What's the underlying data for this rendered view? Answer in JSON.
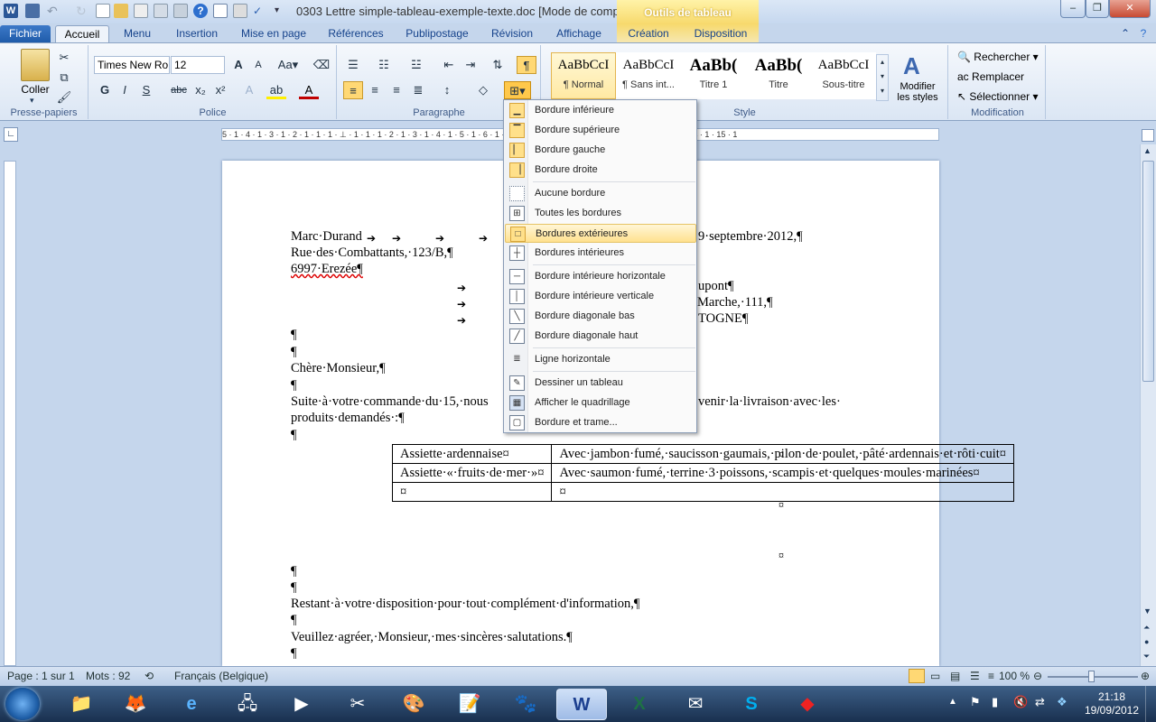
{
  "window": {
    "title": "0303 Lettre simple-tableau-exemple-texte.doc [Mode de comp...",
    "minimize": "–",
    "restore": "❐",
    "close": "✕"
  },
  "context_tab": {
    "label": "Outils de tableau"
  },
  "tabs": [
    "Fichier",
    "Accueil",
    "Menu",
    "Insertion",
    "Mise en page",
    "Références",
    "Publipostage",
    "Révision",
    "Affichage",
    "Création",
    "Disposition"
  ],
  "ribbon": {
    "clipboard": {
      "paste": "Coller",
      "label": "Presse-papiers"
    },
    "font": {
      "name": "Times New Ro",
      "size": "12",
      "label": "Police"
    },
    "paragraph": {
      "label": "Paragraphe"
    },
    "styles": {
      "label": "Style",
      "items": [
        {
          "preview": "AaBbCcI",
          "name": "¶ Normal"
        },
        {
          "preview": "AaBbCcI",
          "name": "¶ Sans int..."
        },
        {
          "preview": "AaBb(",
          "name": "Titre 1"
        },
        {
          "preview": "AaBb(",
          "name": "Titre"
        },
        {
          "preview": "AaBbCcI",
          "name": "Sous-titre"
        }
      ],
      "change_styles": "Modifier les styles"
    },
    "editing": {
      "label": "Modification",
      "find": "Rechercher",
      "replace": "Remplacer",
      "select": "Sélectionner"
    }
  },
  "ruler_text": "5 · 1 · 4 · 1 · 3 · 1 · 2 · 1 · 1 · 1 · ⊥ · 1 · 1 · 1 · 2 · 1 · 3 · 1 · 4 · 1 · 5 · 1 · 6 · 1 · 7 · 1 · 8 · 1 · 9 · 1 · 10 · 1 · 11 · 1 · 12 · 1 · 13 · 1 · 14 · 1 · 15 · 1",
  "document": {
    "line_sender1": "Marc·Durand",
    "line_date": "9·septembre·2012,¶",
    "line_sender2": "Rue·des·Combattants,·123/B,¶",
    "line_sender3": "6997·Erezée¶",
    "line_r1": "upont¶",
    "line_r2": "Marche,·111,¶",
    "line_r3": "TOGNE¶",
    "line_greet": "Chère·Monsieur,¶",
    "line_body1a": "Suite·à·votre·commande·du·15,·nous",
    "line_body1b": "venir·la·livraison·avec·les·",
    "line_body2": "produits·demandés·:¶",
    "pilcrow": "¶",
    "table": [
      [
        "Assiette·ardennaise¤",
        "Avec·jambon·fumé,·saucisson·gaumais,·pilon·de·poulet,·pâté·ardennais·et·rôti·cuit¤"
      ],
      [
        "Assiette·«·fruits·de·mer·»¤",
        "Avec·saumon·fumé,·terrine·3·poissons,·scampis·et·quelques·moules·marinées¤"
      ],
      [
        "¤",
        "¤"
      ]
    ],
    "cell_end": "¤",
    "line_close1": "Restant·à·votre·disposition·pour·tout·complément·d'information,¶",
    "line_close2": "Veuillez·agréer,·Monsieur,·mes·sincères·salutations.¶"
  },
  "border_menu": [
    "Bordure inférieure",
    "Bordure supérieure",
    "Bordure gauche",
    "Bordure droite",
    "Aucune bordure",
    "Toutes les bordures",
    "Bordures extérieures",
    "Bordures intérieures",
    "Bordure intérieure horizontale",
    "Bordure intérieure verticale",
    "Bordure diagonale bas",
    "Bordure diagonale haut",
    "Ligne horizontale",
    "Dessiner un tableau",
    "Afficher le quadrillage",
    "Bordure et trame..."
  ],
  "border_menu_highlighted": "Bordures extérieures",
  "status": {
    "page": "Page : 1 sur 1",
    "words": "Mots : 92",
    "language": "Français (Belgique)",
    "zoom": "100 %"
  },
  "clock": {
    "time": "21:18",
    "date": "19/09/2012"
  }
}
